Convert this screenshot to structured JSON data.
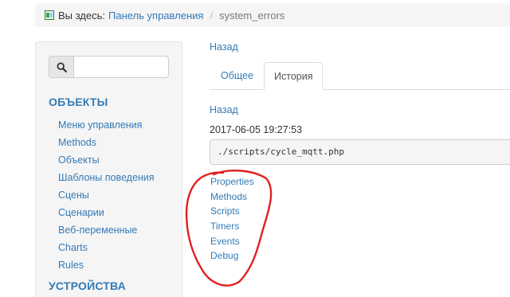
{
  "breadcrumb": {
    "prefix": "Вы здесь:",
    "home": "Панель управления",
    "separator": "/",
    "current": "system_errors"
  },
  "sidebar": {
    "search": {
      "placeholder": "",
      "value": ""
    },
    "section_objects": "ОБЪЕКТЫ",
    "items": [
      "Меню управления",
      "Methods",
      "Объекты",
      "Шаблоны поведения",
      "Сцены",
      "Сценарии",
      "Веб-переменные",
      "Charts",
      "Rules"
    ],
    "section_devices": "УСТРОЙСТВА"
  },
  "main": {
    "back_top": "Назад",
    "tabs": [
      {
        "label": "Общее",
        "active": false
      },
      {
        "label": "История",
        "active": true
      }
    ],
    "back_history": "Назад",
    "timestamp": "2017-06-05 19:27:53",
    "code": "./scripts/cycle_mqtt.php",
    "links": [
      "Properties",
      "Methods",
      "Scripts",
      "Timers",
      "Events",
      "Debug"
    ]
  },
  "colors": {
    "link": "#337ab7",
    "annotation": "#e02020",
    "panel_bg": "#f5f5f5"
  },
  "icons": {
    "breadcrumb": "control-panel-icon",
    "search": "search-icon"
  }
}
